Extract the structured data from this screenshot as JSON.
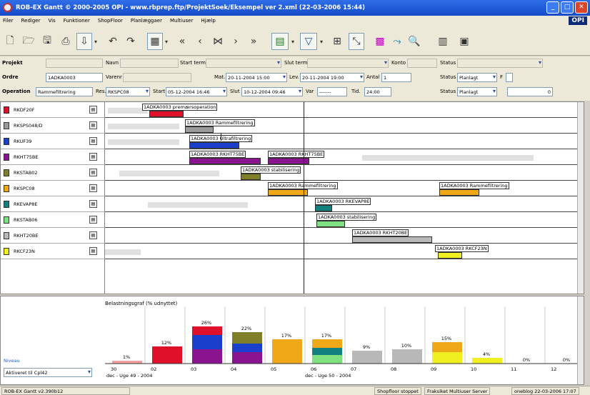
{
  "window": {
    "title": "ROB-EX Gantt © 2000-2005 OPI - www.rbprep.ftp/ProjektSoek/Eksempel ver 2.xml (22-03-2006 15:44)",
    "logo": "OPI"
  },
  "menu": [
    "Filer",
    "Rediger",
    "Vis",
    "Funktioner",
    "ShopFloor",
    "Planlæggaer",
    "Multiuser",
    "Hjælp"
  ],
  "form": {
    "projekt_label": "Projekt",
    "navn_label": "Navn",
    "start_termin_label": "Start termin",
    "slut_termin_label": "Slut termin",
    "konto_label": "Konto",
    "status_label": "Status",
    "ordre_label": "Ordre",
    "ordre_value": "1ADKA0003",
    "varenr_label": "Varenr",
    "mat_label": "Mat.",
    "mat_value": "20-11-2004 15:00",
    "lev_label": "Lev.",
    "lev_value": "20-11-2004 19:00",
    "antal_label": "Antal",
    "antal_value": "1",
    "status2_label": "Status",
    "status2_value": "Planlagt",
    "f_label": "F",
    "operation_label": "Operation",
    "operation_value": "Rammefiltrering",
    "res_label": "Res.",
    "res_value": "RKSPC08",
    "start_label": "Start",
    "start_value": "05-12-2004 16:46",
    "slut_label": "Slut",
    "slut_value": "10-12-2004 09:46",
    "var_label": "Var",
    "var_value": "-------",
    "tid_label": "Tid.",
    "tid_value": "24:00",
    "status3_label": "Status",
    "status3_value": "Planlagt",
    "count_value": "0"
  },
  "resources": [
    {
      "name": "RKDF20F",
      "color": "#e0102a"
    },
    {
      "name": "RKSPS048/D",
      "color": "#9a9a9a"
    },
    {
      "name": "RKUF39",
      "color": "#1a3fcc"
    },
    {
      "name": "RKHT75BE",
      "color": "#8a1490"
    },
    {
      "name": "RKSTAB02",
      "color": "#7f7f2a"
    },
    {
      "name": "RKSPC08",
      "color": "#f0a818"
    },
    {
      "name": "RKEVAP8E",
      "color": "#138080"
    },
    {
      "name": "RKSTAB06",
      "color": "#7ee07e"
    },
    {
      "name": "RKHT20BE",
      "color": "#b8b8b8"
    },
    {
      "name": "RKCF23N",
      "color": "#f0f020"
    }
  ],
  "labels": {
    "l0": "1ADKA0003 premærsoperation",
    "l1": "1ADKA0003 Rammefiltrering",
    "l2": "1ADKA0003 Ultrafiltrering",
    "l3a": "1ADKA0003 RKHT75BE",
    "l3b": "1ADKA0003 RKHT75BE",
    "l4": "1ADKA0003 stabilisering",
    "l5a": "1ADKA0003 Rammefiltrering",
    "l5b": "1ADKA0003 Rammefiltrering",
    "l6": "1ADKA0003 RKEVAP8E",
    "l7": "1ADKA0003 stabilisering",
    "l8": "1ADKA0003 RKHT20BE",
    "l9": "1ADKA0003 RKCF23N"
  },
  "load": {
    "title": "Belastningsgraf (% udnyttet)",
    "days": [
      "30",
      "02",
      "03",
      "04",
      "05",
      "06",
      "07",
      "08",
      "09",
      "10",
      "11",
      "12"
    ],
    "percents": [
      "1%",
      "12%",
      "26%",
      "22%",
      "17%",
      "17%",
      "9%",
      "10%",
      "15%",
      "4%",
      "0%",
      "0%"
    ],
    "week1": "dec - Uge 49 - 2004",
    "week2": "dec - Uge 50 - 2004",
    "view_label": "Niveau",
    "select_value": "Aktiveret til  Cpl42"
  },
  "status": {
    "version": "ROB-EX Gantt v2.390b12",
    "shopfloor": "Shopfloor stoppet",
    "multiuser": "Fraksiket Multiuser Server",
    "user": "oneblog 22-03-2006 17:07"
  }
}
